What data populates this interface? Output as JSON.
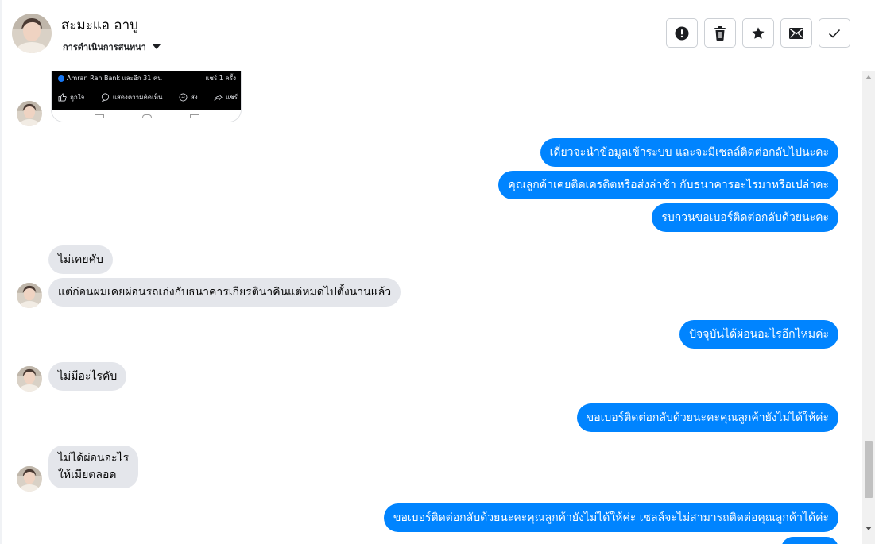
{
  "header": {
    "contact_name": "สะมะแอ อาบู",
    "conversation_actions_label": "การดำเนินการสนทนา",
    "toolbar": [
      {
        "name": "mark-spam-button",
        "icon": "alert-icon"
      },
      {
        "name": "delete-button",
        "icon": "trash-icon"
      },
      {
        "name": "star-button",
        "icon": "star-icon"
      },
      {
        "name": "mark-unread-button",
        "icon": "envelope-icon"
      },
      {
        "name": "mark-done-button",
        "icon": "check-icon"
      }
    ]
  },
  "shared_post": {
    "reactions_text": "Amran Ran Bank และอีก 31 คน",
    "shares_text": "แชร์ 1 ครั้ง",
    "like_label": "ถูกใจ",
    "comment_label": "แสดงความคิดเห็น",
    "send_label": "ส่ง",
    "share_label": "แชร์"
  },
  "messages": [
    {
      "dir": "out",
      "text": "เดี๋ยวจะนำข้อมูลเข้าระบบ และจะมีเซลล์ติดต่อกลับไปนะคะ"
    },
    {
      "dir": "out",
      "text": "คุณลูกค้าเคยติดเครดิตหรือส่งล่าช้า กับธนาคารอะไรมาหรือเปล่าคะ"
    },
    {
      "dir": "out",
      "text": "รบกวนขอเบอร์ติดต่อกลับด้วยนะคะ"
    },
    {
      "dir": "in",
      "text": "ไม่เคยคับ"
    },
    {
      "dir": "in",
      "text": "แต่ก่อนผมเคยผ่อนรถเก่งกับธนาคารเกียรตินาคินแต่หมดไปตั้งนานแล้ว"
    },
    {
      "dir": "out",
      "text": "ปัจจุบันได้ผ่อนอะไรอีกไหมค่ะ"
    },
    {
      "dir": "in",
      "text": "ไม่มีอะไรคับ"
    },
    {
      "dir": "out",
      "text": "ขอเบอร์ติดต่อกลับด้วยนะคะคุณลูกค้ายังไม่ได้ให้ค่ะ"
    },
    {
      "dir": "in",
      "line1": "ไม่ได้ผ่อนอะไร",
      "line2": "ให้เมียตลอด"
    },
    {
      "dir": "out",
      "text": "ขอเบอร์ติดต่อกลับด้วยนะคะคุณลูกค้ายังไม่ได้ให้ค่ะ เซลล์จะไม่สามารถติดต่อคุณลูกค้าได้ค่ะ"
    }
  ],
  "colors": {
    "outgoing_bubble": "#0084ff",
    "incoming_bubble": "#e4e6eb"
  }
}
